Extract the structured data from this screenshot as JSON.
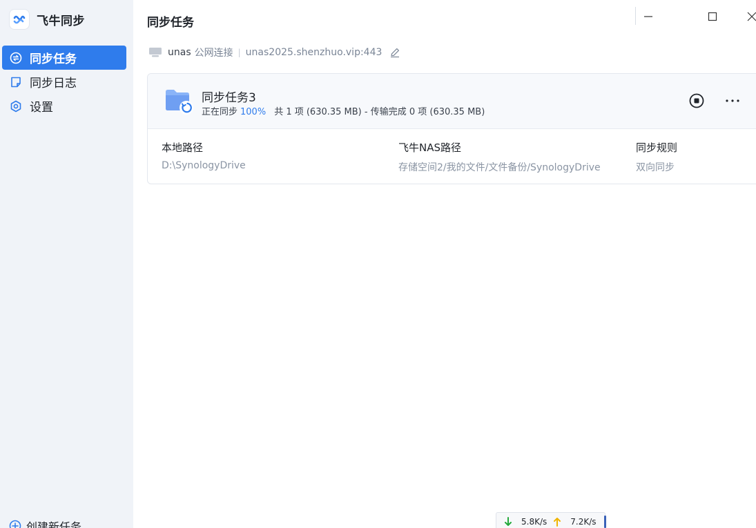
{
  "app": {
    "name": "飞牛同步"
  },
  "sidebar": {
    "items": [
      {
        "label": "同步任务",
        "icon": "sync-icon",
        "active": true
      },
      {
        "label": "同步日志",
        "icon": "log-icon",
        "active": false
      },
      {
        "label": "设置",
        "icon": "gear-icon",
        "active": false
      }
    ],
    "create_label": "创建新任务"
  },
  "header": {
    "title": "同步任务"
  },
  "connection": {
    "device": "unas",
    "mode": "公网连接",
    "address": "unas2025.shenzhuo.vip:443"
  },
  "task": {
    "name": "同步任务3",
    "status": "正在同步",
    "percent": "100%",
    "summary": "共 1 项 (630.35 MB) - 传输完成 0 项 (630.35 MB)",
    "local_label": "本地路径",
    "local_path": "D:\\SynologyDrive",
    "nas_label": "飞牛NAS路径",
    "nas_path": "存储空间2/我的文件/文件备份/SynologyDrive",
    "rule_label": "同步规则",
    "rule_value": "双向同步"
  },
  "speed": {
    "down": "5.8K/s",
    "up": "7.2K/s"
  },
  "colors": {
    "accent": "#2f7cec",
    "sidebar_bg": "#f0f3f8",
    "down_arrow": "#22a83a",
    "up_arrow": "#f0b400"
  }
}
